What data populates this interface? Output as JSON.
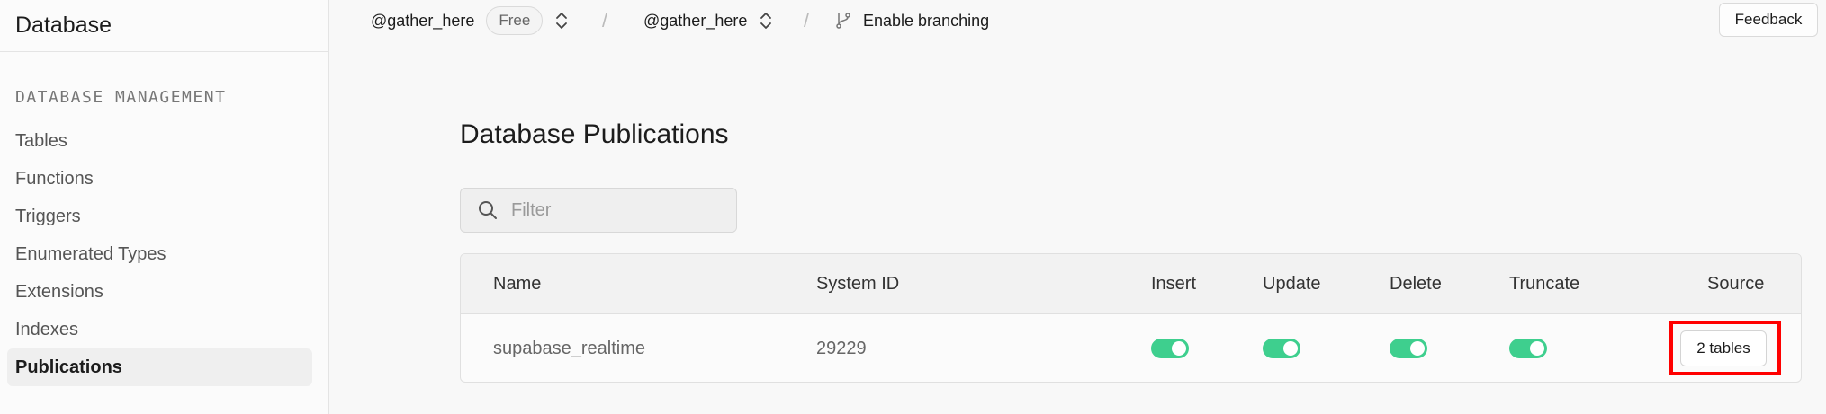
{
  "sidebar": {
    "title": "Database",
    "section_label": "DATABASE MANAGEMENT",
    "items": [
      {
        "label": "Tables"
      },
      {
        "label": "Functions"
      },
      {
        "label": "Triggers"
      },
      {
        "label": "Enumerated Types"
      },
      {
        "label": "Extensions"
      },
      {
        "label": "Indexes"
      },
      {
        "label": "Publications",
        "active": true
      }
    ]
  },
  "topbar": {
    "org": "@gather_here",
    "plan_badge": "Free",
    "separator": "/",
    "project": "@gather_here",
    "branching": "Enable branching",
    "feedback": "Feedback"
  },
  "main": {
    "title": "Database Publications",
    "filter": {
      "placeholder": "Filter",
      "value": ""
    },
    "table": {
      "columns": [
        "Name",
        "System ID",
        "Insert",
        "Update",
        "Delete",
        "Truncate",
        "Source"
      ],
      "rows": [
        {
          "name": "supabase_realtime",
          "system_id": "29229",
          "insert": true,
          "update": true,
          "delete": true,
          "truncate": true,
          "source": "2 tables"
        }
      ]
    }
  },
  "colors": {
    "accent": "#3ecf8e",
    "highlight": "#ff0000"
  }
}
